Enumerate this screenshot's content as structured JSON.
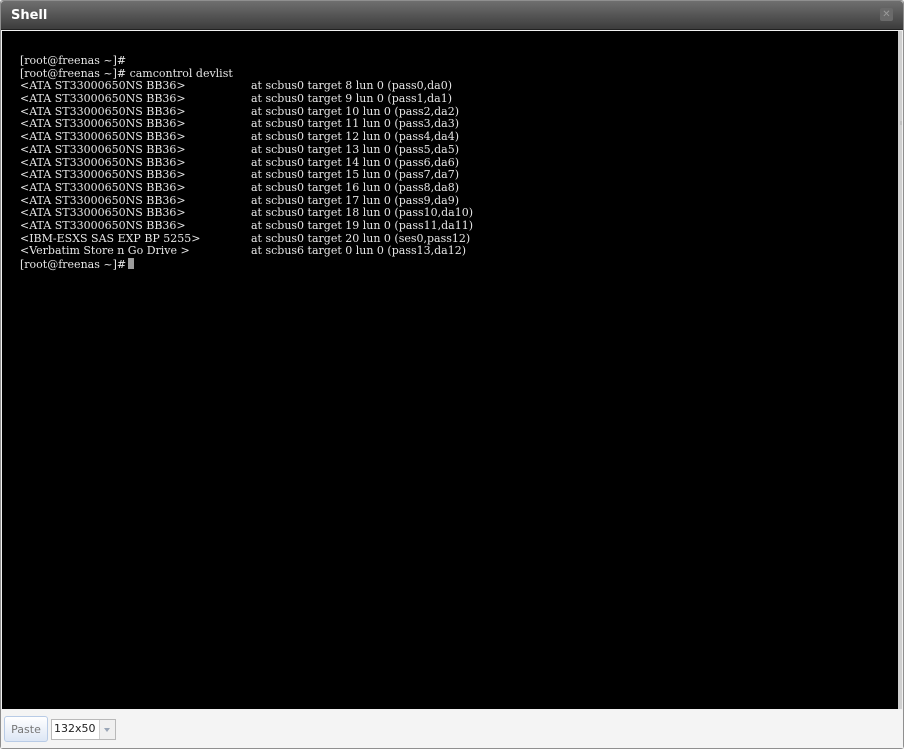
{
  "window": {
    "title": "Shell",
    "close_icon": "close-icon"
  },
  "terminal": {
    "lines": [
      {
        "a": "[root@freenas ~]#",
        "b": ""
      },
      {
        "a": "[root@freenas ~]# camcontrol devlist",
        "b": ""
      },
      {
        "a": "<ATA ST33000650NS BB36>",
        "b": "at scbus0 target 8 lun 0 (pass0,da0)"
      },
      {
        "a": "<ATA ST33000650NS BB36>",
        "b": "at scbus0 target 9 lun 0 (pass1,da1)"
      },
      {
        "a": "<ATA ST33000650NS BB36>",
        "b": "at scbus0 target 10 lun 0 (pass2,da2)"
      },
      {
        "a": "<ATA ST33000650NS BB36>",
        "b": "at scbus0 target 11 lun 0 (pass3,da3)"
      },
      {
        "a": "<ATA ST33000650NS BB36>",
        "b": "at scbus0 target 12 lun 0 (pass4,da4)"
      },
      {
        "a": "<ATA ST33000650NS BB36>",
        "b": "at scbus0 target 13 lun 0 (pass5,da5)"
      },
      {
        "a": "<ATA ST33000650NS BB36>",
        "b": "at scbus0 target 14 lun 0 (pass6,da6)"
      },
      {
        "a": "<ATA ST33000650NS BB36>",
        "b": "at scbus0 target 15 lun 0 (pass7,da7)"
      },
      {
        "a": "<ATA ST33000650NS BB36>",
        "b": "at scbus0 target 16 lun 0 (pass8,da8)"
      },
      {
        "a": "<ATA ST33000650NS BB36>",
        "b": "at scbus0 target 17 lun 0 (pass9,da9)"
      },
      {
        "a": "<ATA ST33000650NS BB36>",
        "b": "at scbus0 target 18 lun 0 (pass10,da10)"
      },
      {
        "a": "<ATA ST33000650NS BB36>",
        "b": "at scbus0 target 19 lun 0 (pass11,da11)"
      },
      {
        "a": "<IBM-ESXS SAS EXP BP 5255>",
        "b": "at scbus0 target 20 lun 0 (ses0,pass12)"
      },
      {
        "a": "<Verbatim Store n Go Drive >",
        "b": "at scbus6 target 0 lun 0 (pass13,da12)"
      },
      {
        "a": "[root@freenas ~]#",
        "b": "",
        "cursor": true
      }
    ],
    "background": "#000000",
    "foreground": "#e6e6e6"
  },
  "toolbar": {
    "paste_label": "Paste",
    "size_value": "132x50"
  }
}
